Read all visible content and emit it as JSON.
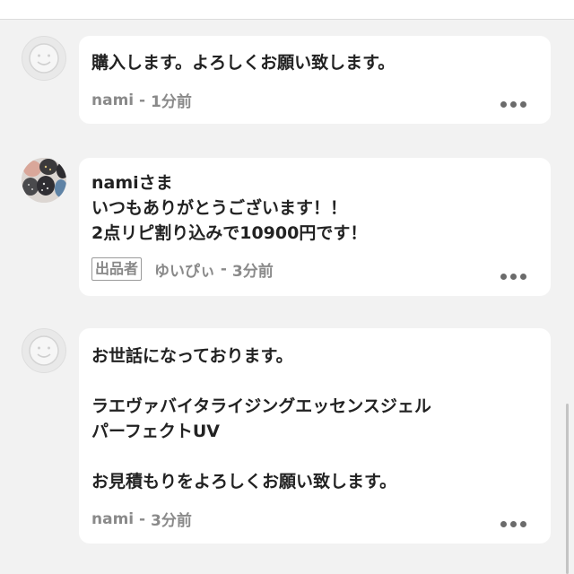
{
  "comments": [
    {
      "author_type": "buyer",
      "body_lines": [
        "購入します。よろしくお願い致します。"
      ],
      "author": "nami",
      "time": "1分前",
      "avatar_icon": "default-avatar-icon"
    },
    {
      "author_type": "seller",
      "body_lines": [
        "namiさま",
        "いつもありがとうございます！！",
        "2点リピ割り込みで10900円です！"
      ],
      "seller_badge": "出品者",
      "author": "ゆいぴぃ",
      "time": "3分前",
      "avatar_icon": "user-photo-avatar"
    },
    {
      "author_type": "buyer",
      "body_lines": [
        "お世話になっております。",
        "",
        "ラエヴァバイタライジングエッセンスジェル",
        "パーフェクトUV",
        "",
        "お見積もりをよろしくお願い致します。"
      ],
      "author": "nami",
      "time": "3分前",
      "avatar_icon": "default-avatar-icon"
    }
  ],
  "meta_separator": " - ",
  "more_icon": "more-dots-icon",
  "colors": {
    "background": "#f2f2f2",
    "card": "#ffffff",
    "text": "#222222",
    "meta": "#8a8a8a"
  }
}
